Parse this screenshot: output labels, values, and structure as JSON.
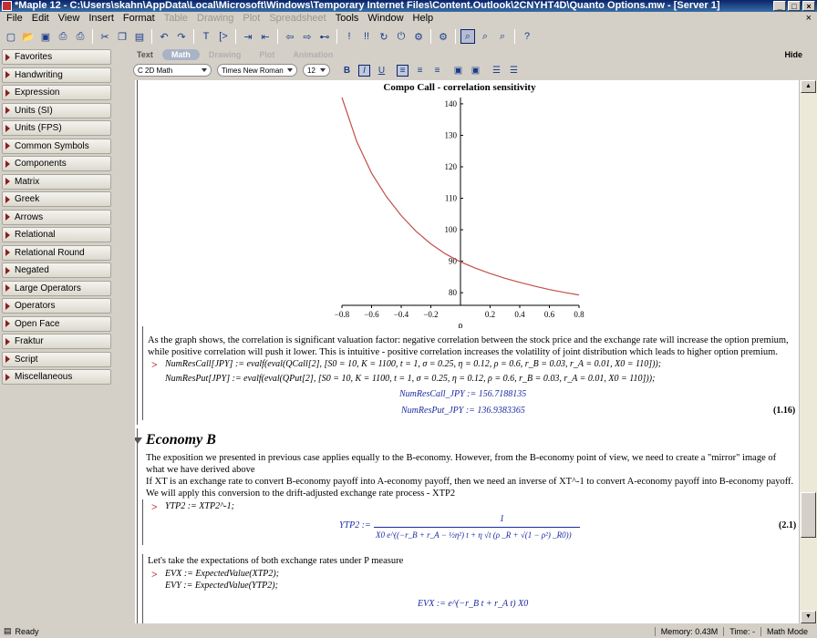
{
  "window": {
    "title": "*Maple 12 - C:\\Users\\skahn\\AppData\\Local\\Microsoft\\Windows\\Temporary Internet Files\\Content.Outlook\\2CNYHT4D\\Quanto Options.mw - [Server 1]",
    "controls": [
      "_",
      "□",
      "×"
    ]
  },
  "menu": {
    "items": [
      {
        "label": "File",
        "enabled": true
      },
      {
        "label": "Edit",
        "enabled": true
      },
      {
        "label": "View",
        "enabled": true
      },
      {
        "label": "Insert",
        "enabled": true
      },
      {
        "label": "Format",
        "enabled": true
      },
      {
        "label": "Table",
        "enabled": false
      },
      {
        "label": "Drawing",
        "enabled": false
      },
      {
        "label": "Plot",
        "enabled": false
      },
      {
        "label": "Spreadsheet",
        "enabled": false
      },
      {
        "label": "Tools",
        "enabled": true
      },
      {
        "label": "Window",
        "enabled": true
      },
      {
        "label": "Help",
        "enabled": true
      }
    ],
    "close_doc": "×"
  },
  "toolbar": {
    "icons": [
      "new-icon",
      "open-icon",
      "save-icon",
      "print-icon",
      "print-preview-icon",
      "sep",
      "cut-icon",
      "copy-icon",
      "paste-icon",
      "sep",
      "undo-icon",
      "redo-icon",
      "sep",
      "text-icon",
      "math-icon",
      "sep",
      "section-icon",
      "unsection-icon",
      "sep",
      "back-icon",
      "forward-icon",
      "hyperlink-icon",
      "sep",
      "execute-icon",
      "execute-all-icon",
      "restart-icon",
      "interrupt-icon",
      "debug-icon",
      "sep",
      "settings-icon",
      "sep",
      "zoom-1-icon",
      "zoom-2-icon",
      "zoom-3-icon",
      "sep",
      "help-icon"
    ]
  },
  "palettes": [
    "Favorites",
    "Handwriting",
    "Expression",
    "Units (SI)",
    "Units (FPS)",
    "Common Symbols",
    "Components",
    "Matrix",
    "Greek",
    "Arrows",
    "Relational",
    "Relational Round",
    "Negated",
    "Large Operators",
    "Operators",
    "Open Face",
    "Fraktur",
    "Script",
    "Miscellaneous"
  ],
  "modes": {
    "tabs": [
      {
        "label": "Text",
        "active": false,
        "enabled": true
      },
      {
        "label": "Math",
        "active": true,
        "enabled": true
      },
      {
        "label": "Drawing",
        "active": false,
        "enabled": false
      },
      {
        "label": "Plot",
        "active": false,
        "enabled": false
      },
      {
        "label": "Animation",
        "active": false,
        "enabled": false
      }
    ],
    "hide_label": "Hide"
  },
  "format": {
    "style": "2D Math",
    "style_prefix": "C",
    "font": "Times New Roman",
    "size": "12"
  },
  "chart_data": {
    "type": "line",
    "title": "Compo Call - correlation sensitivity",
    "xlabel": "ρ",
    "ylabel": "",
    "xlim": [
      -0.8,
      0.8
    ],
    "ylim": [
      76,
      142
    ],
    "xticks": [
      "−0.8",
      "−0.6",
      "−0.4",
      "−0.2",
      "0.2",
      "0.4",
      "0.6",
      "0.8"
    ],
    "yticks": [
      "80",
      "90",
      "100",
      "110",
      "120",
      "130",
      "140"
    ],
    "color": "#c0504d",
    "series": [
      {
        "x": [
          -0.8,
          -0.7,
          -0.6,
          -0.5,
          -0.4,
          -0.3,
          -0.2,
          -0.1,
          0,
          0.1,
          0.2,
          0.3,
          0.4,
          0.5,
          0.6,
          0.7,
          0.8
        ],
        "y": [
          142,
          128,
          118,
          110.5,
          104.5,
          99.5,
          95.5,
          92.3,
          89.8,
          87.8,
          86.1,
          84.6,
          83.3,
          82.1,
          81,
          80.1,
          79.3
        ]
      }
    ]
  },
  "doc": {
    "para1": "As the graph shows, the correlation is significant valuation factor: negative correlation between the stock price and the exchange rate will increase the option premium, while positive correlation will push it lower. This is intuitive - positive correlation increases the volatility of joint distribution which leads to higher option premium.",
    "prompt": ">",
    "input1a": "NumResCall[JPY] := evalf(eval(QCall[2], [S0 = 10, K = 1100, t = 1, σ = 0.25, η = 0.12, ρ = 0.6, r_B = 0.03, r_A = 0.01, X0 = 110]));",
    "input1b": "NumResPut[JPY] := evalf(eval(QPut[2], [S0 = 10, K = 1100, t = 1, σ = 0.25, η = 0.12, ρ = 0.6, r_B = 0.03, r_A = 0.01, X0 = 110]));",
    "output1a": "NumResCall_JPY := 156.7188135",
    "output1b": "NumResPut_JPY := 136.9383365",
    "label1": "(1.16)",
    "section_title": "Economy B",
    "para2": "The exposition we presented in previous case applies equally to the B-economy. However, from the B-economy point of view, we need to create a \"mirror\" image of what we have derived above",
    "para3": "If XT is an exchange rate to convert B-economy payoff into A-economy payoff, then we need an inverse of XT^-1 to convert A-economy payoff into B-economy payoff. We will apply this conversion to the drift-adjusted exchange rate process - XTP2",
    "input2": "YTP2 := XTP2^-1;",
    "output2_lhs": "YTP2 :=",
    "output2_num": "1",
    "output2_den": "X0 e^((−r_B + r_A − ½η²) t + η √t (ρ _R + √(1 − ρ²) _R0))",
    "label2": "(2.1)",
    "para4": "Let's take the expectations of both exchange rates under P measure",
    "input3a": "EVX := ExpectedValue(XTP2);",
    "input3b": "EVY := ExpectedValue(YTP2);",
    "output3a": "EVX := e^(−r_B t + r_A t) X0"
  },
  "status": {
    "ready": "Ready",
    "memory": "Memory: 0.43M",
    "time": "Time: -",
    "mode": "Math Mode"
  }
}
